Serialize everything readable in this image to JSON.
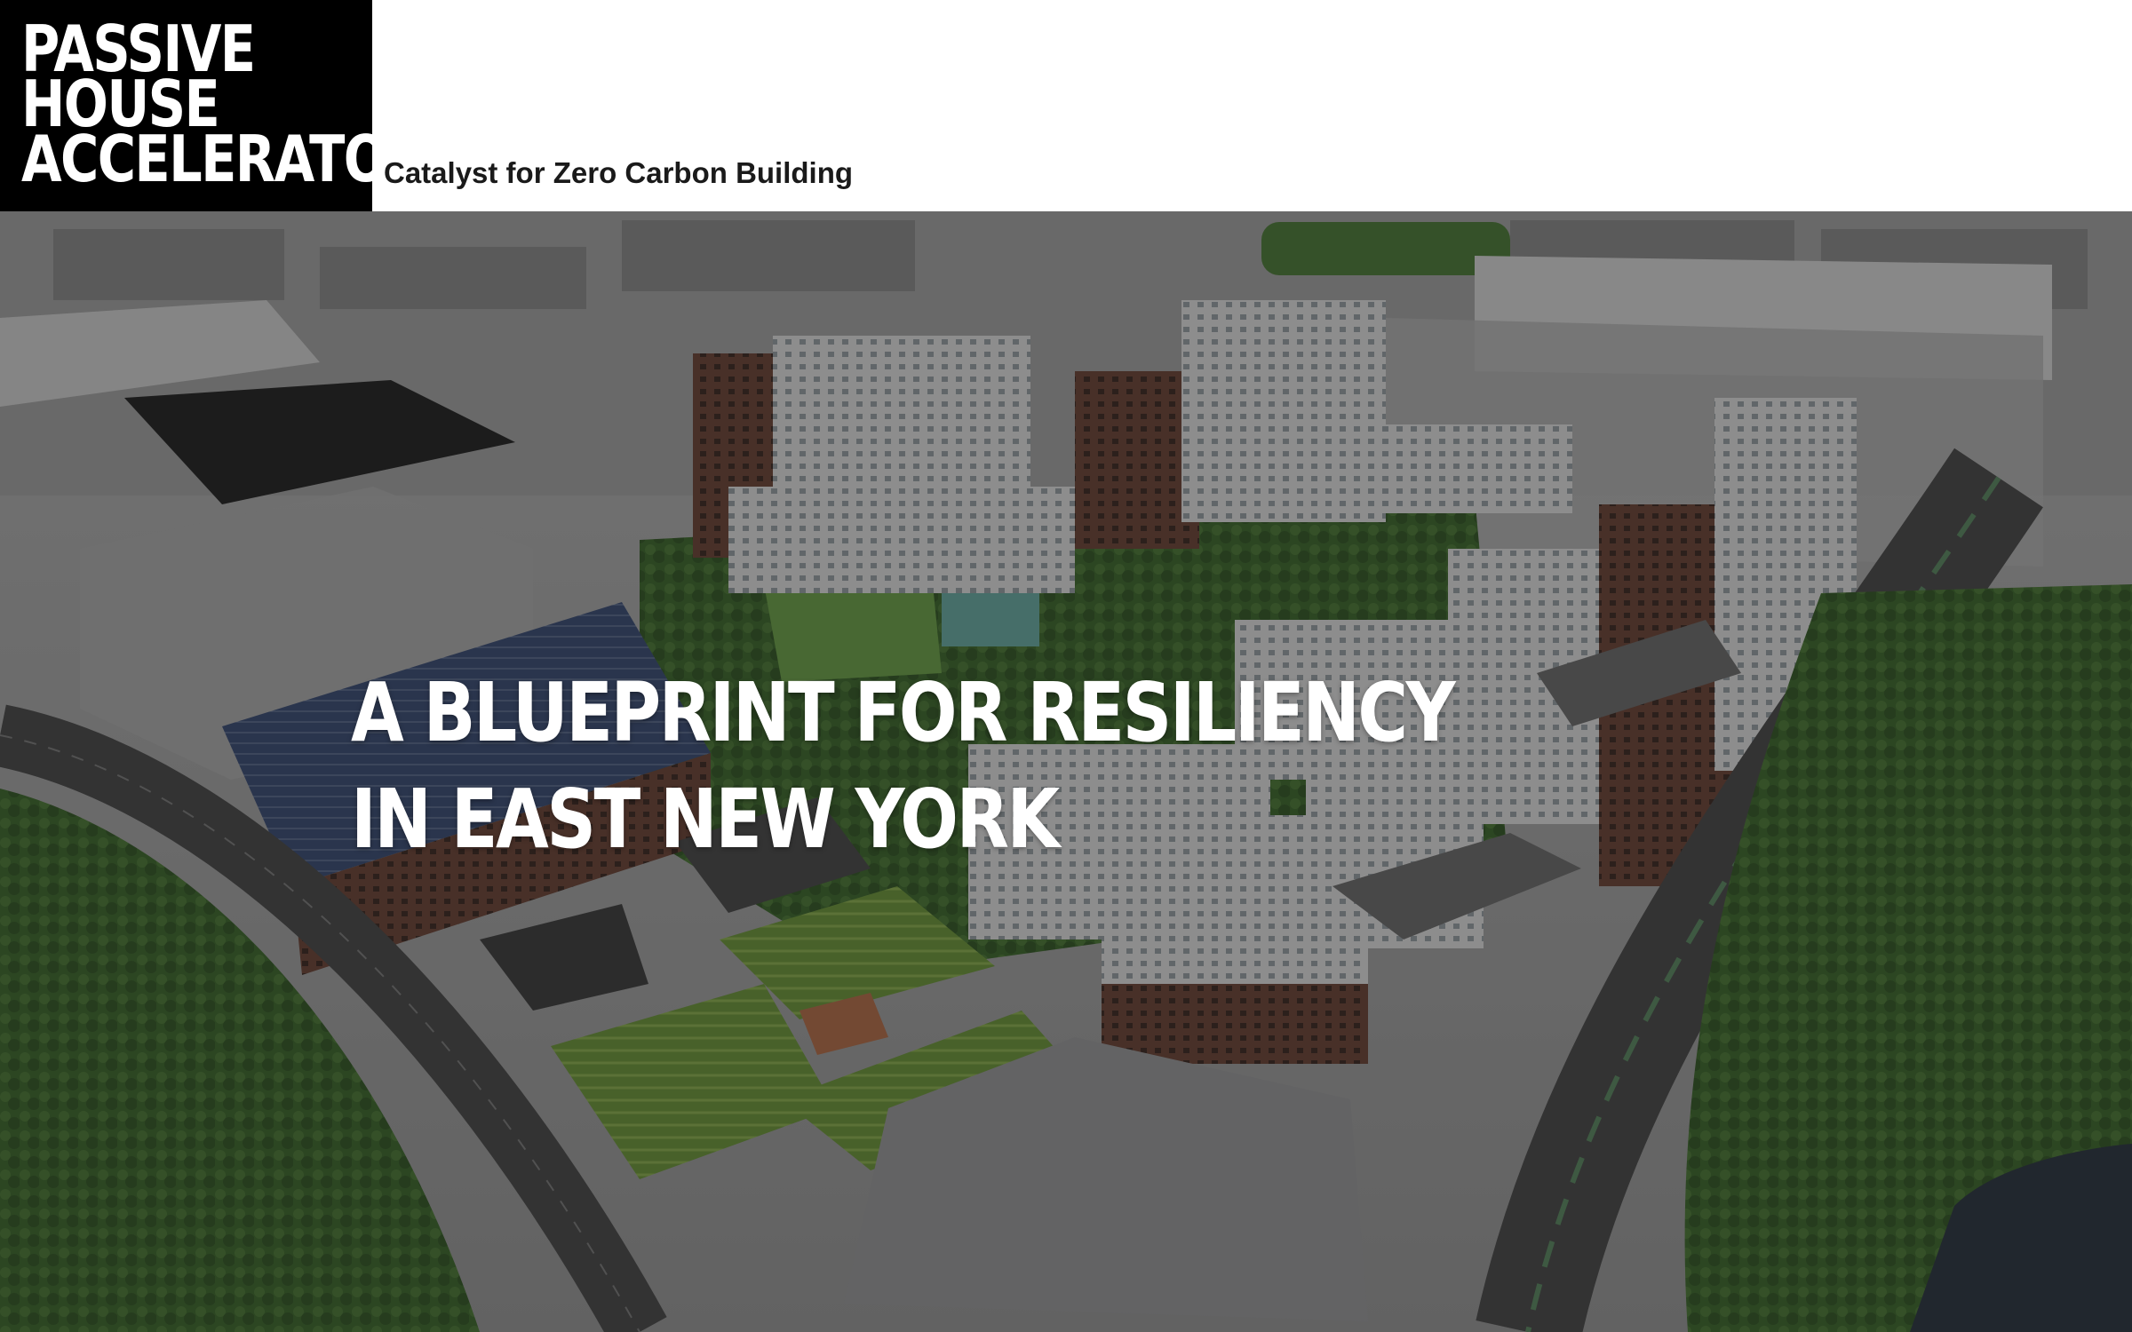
{
  "brand": {
    "logo_lines": [
      "PASSIVE",
      "HOUSE",
      "ACCELERATOR"
    ],
    "tagline": "Catalyst for Zero Carbon Building"
  },
  "hero": {
    "image_icon": "aerial-development-illustration",
    "title": "A BLUEPRINT FOR RESILIENCY IN EAST NEW YORK"
  },
  "colors": {
    "logo_bg": "#000000",
    "logo_text": "#ffffff",
    "tagline": "#1a1a1a",
    "hero_title": "#ffffff"
  }
}
